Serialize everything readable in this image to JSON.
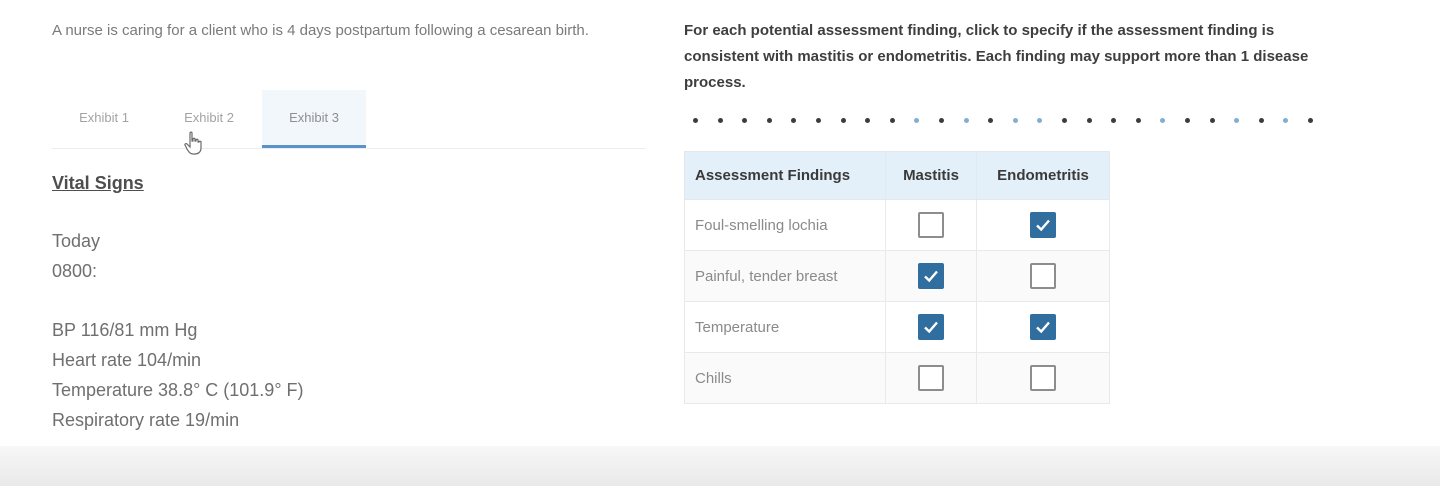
{
  "scenario": "A nurse is caring for a client who is 4 days postpartum following a cesarean birth.",
  "tabs": [
    {
      "label": "Exhibit 1",
      "active": false
    },
    {
      "label": "Exhibit 2",
      "active": false
    },
    {
      "label": "Exhibit 3",
      "active": true
    }
  ],
  "exhibit": {
    "title": "Vital Signs",
    "day": "Today",
    "time": "0800:",
    "bp": "BP 116/81 mm Hg",
    "heart_rate": "Heart rate 104/min",
    "temperature": "Temperature 38.8° C (101.9° F)",
    "respiratory_rate": "Respiratory rate 19/min"
  },
  "instructions": "For each potential assessment finding, click to specify if the assessment finding is consistent with mastitis or endometritis. Each finding may support more than 1 disease process.",
  "progress_dots": [
    "dark",
    "dark",
    "dark",
    "dark",
    "dark",
    "dark",
    "dark",
    "dark",
    "dark",
    "blue",
    "dark",
    "blue",
    "dark",
    "blue",
    "blue",
    "dark",
    "dark",
    "dark",
    "dark",
    "blue",
    "dark",
    "dark",
    "blue",
    "dark",
    "blue",
    "dark"
  ],
  "table": {
    "headers": [
      "Assessment Findings",
      "Mastitis",
      "Endometritis"
    ],
    "rows": [
      {
        "finding": "Foul-smelling lochia",
        "mastitis": false,
        "endometritis": true
      },
      {
        "finding": "Painful, tender breast",
        "mastitis": true,
        "endometritis": false
      },
      {
        "finding": "Temperature",
        "mastitis": true,
        "endometritis": true
      },
      {
        "finding": "Chills",
        "mastitis": false,
        "endometritis": false
      }
    ]
  },
  "colors": {
    "checked": "#2f6e9f",
    "header_bg": "#e3f0fa",
    "active_tab_underline": "#5b93c9"
  }
}
